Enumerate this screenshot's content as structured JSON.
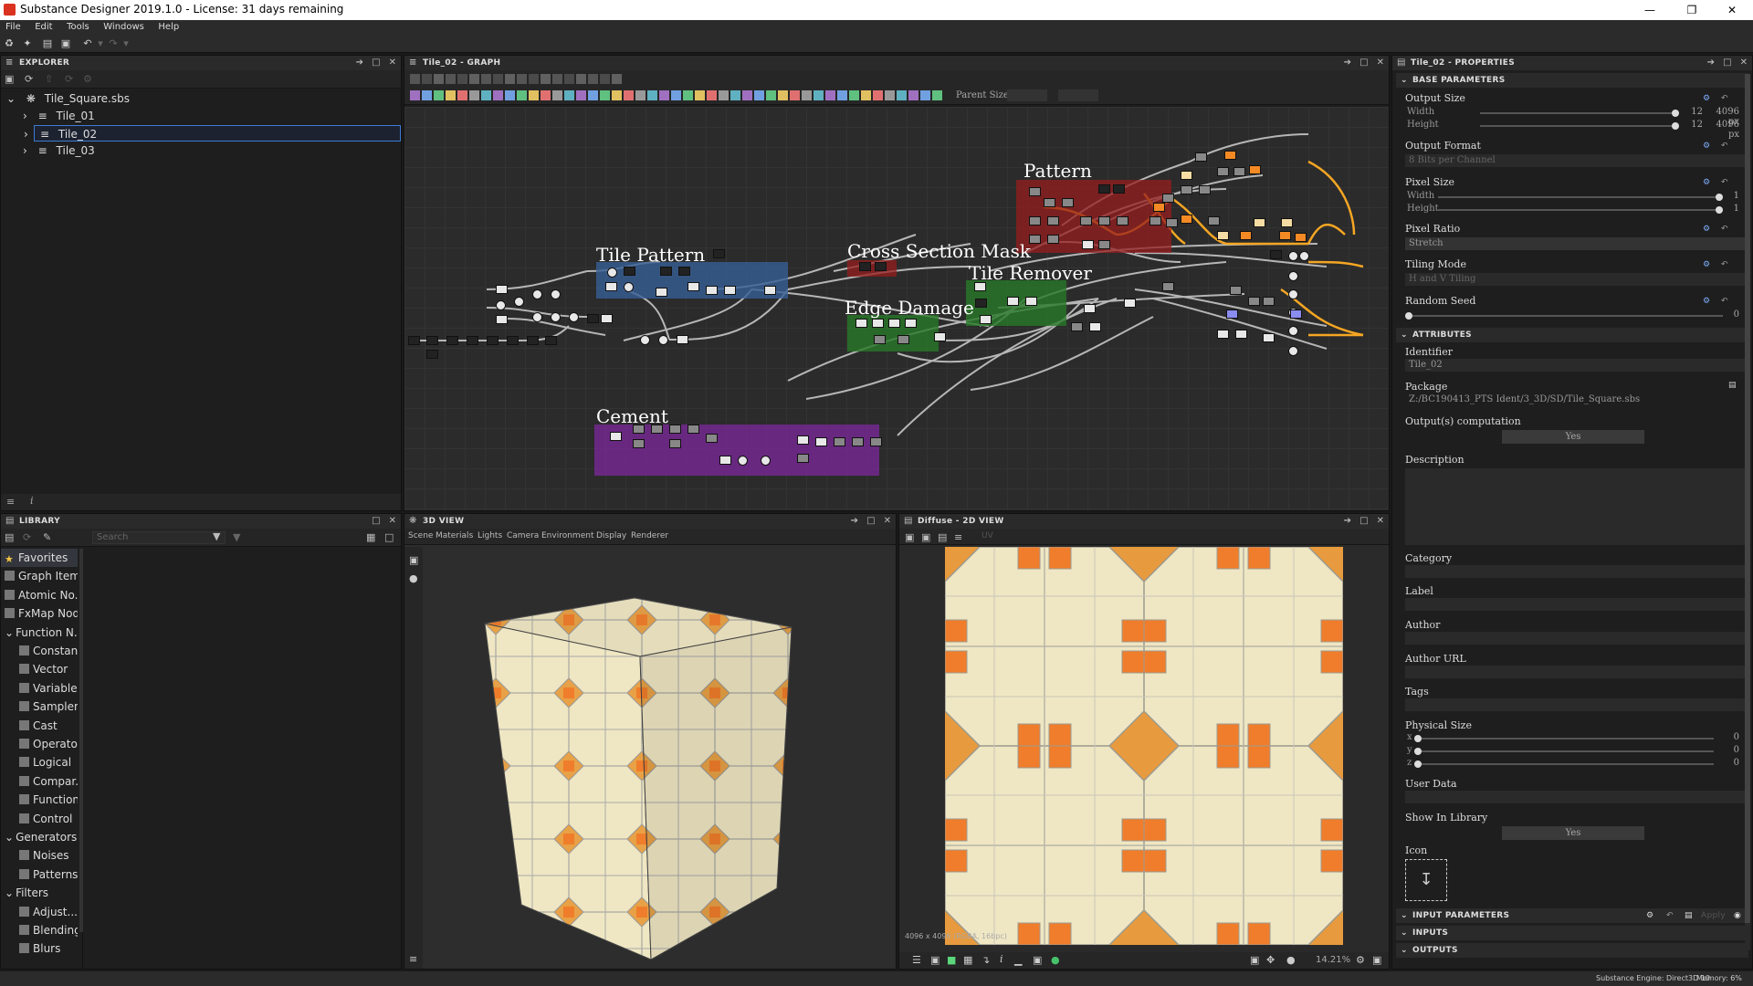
{
  "window": {
    "title": "Substance Designer 2019.1.0 - License: 31 days remaining"
  },
  "menu": [
    "File",
    "Edit",
    "Tools",
    "Windows",
    "Help"
  ],
  "explorer": {
    "title": "EXPLORER",
    "package": "Tile_Square.sbs",
    "graphs": [
      "Tile_01",
      "Tile_02",
      "Tile_03"
    ],
    "selected": "Tile_02"
  },
  "graph_view": {
    "title": "Tile_02 - GRAPH",
    "parent_size_label": "Parent Size:",
    "frames": [
      "Pattern",
      "Tile Pattern",
      "Cross Section Mask",
      "Tile Remover",
      "Edge Damage",
      "Cement"
    ]
  },
  "library": {
    "title": "LIBRARY",
    "search_placeholder": "Search",
    "items": [
      {
        "label": "Favorites",
        "level": 0,
        "selected": true
      },
      {
        "label": "Graph Items",
        "level": 0
      },
      {
        "label": "Atomic No...",
        "level": 0
      },
      {
        "label": "FxMap Nod...",
        "level": 0
      },
      {
        "label": "Function N...",
        "level": 0,
        "expanded": true
      },
      {
        "label": "Constant",
        "level": 1
      },
      {
        "label": "Vector",
        "level": 1
      },
      {
        "label": "Variable",
        "level": 1
      },
      {
        "label": "Sampler",
        "level": 1
      },
      {
        "label": "Cast",
        "level": 1
      },
      {
        "label": "Operator",
        "level": 1
      },
      {
        "label": "Logical",
        "level": 1
      },
      {
        "label": "Compar...",
        "level": 1
      },
      {
        "label": "Function",
        "level": 1
      },
      {
        "label": "Control",
        "level": 1
      },
      {
        "label": "Generators",
        "level": 0,
        "expanded": true
      },
      {
        "label": "Noises",
        "level": 1
      },
      {
        "label": "Patterns",
        "level": 1
      },
      {
        "label": "Filters",
        "level": 0,
        "expanded": true
      },
      {
        "label": "Adjust...",
        "level": 1
      },
      {
        "label": "Blending",
        "level": 1
      },
      {
        "label": "Blurs",
        "level": 1
      }
    ]
  },
  "view3d": {
    "title": "3D VIEW",
    "menus": [
      "Scene",
      "Materials",
      "Lights",
      "Camera",
      "Environment",
      "Display",
      "Renderer"
    ]
  },
  "view2d": {
    "title": "Diffuse - 2D VIEW",
    "uv_label": "UV",
    "resolution": "4096 x 4096 (RGBA, 16bpc)",
    "zoom": "14.21%"
  },
  "properties": {
    "title": "Tile_02 - PROPERTIES",
    "base_section": "BASE PARAMETERS",
    "output_size": {
      "label": "Output Size",
      "width_label": "Width",
      "height_label": "Height",
      "width_value": "12",
      "height_value": "12",
      "width_px": "4096 px",
      "height_px": "4096 px"
    },
    "output_format": {
      "label": "Output Format",
      "value": "8 Bits per Channel"
    },
    "pixel_size": {
      "label": "Pixel Size",
      "width_label": "Width",
      "height_label": "Height",
      "width_value": "1",
      "height_value": "1"
    },
    "pixel_ratio": {
      "label": "Pixel Ratio",
      "value": "Stretch"
    },
    "tiling_mode": {
      "label": "Tiling Mode",
      "value": "H and V Tiling"
    },
    "random_seed": {
      "label": "Random Seed",
      "value": "0"
    },
    "attributes_section": "ATTRIBUTES",
    "identifier": {
      "label": "Identifier",
      "value": "Tile_02"
    },
    "package": {
      "label": "Package",
      "value": "Z:/BC190413_PTS Ident/3_3D/SD/Tile_Square.sbs"
    },
    "outputs_computation": {
      "label": "Output(s) computation",
      "value": "Yes"
    },
    "description_label": "Description",
    "category_label": "Category",
    "label_label": "Label",
    "author_label": "Author",
    "author_url_label": "Author URL",
    "tags_label": "Tags",
    "physical_size": {
      "label": "Physical Size",
      "x_label": "x",
      "y_label": "y",
      "z_label": "z",
      "x": "0",
      "y": "0",
      "z": "0"
    },
    "user_data_label": "User Data",
    "show_in_library": {
      "label": "Show In Library",
      "value": "Yes"
    },
    "icon_label": "Icon",
    "input_params_section": "INPUT PARAMETERS",
    "apply_label": "Apply",
    "inputs_section": "INPUTS",
    "outputs_section": "OUTPUTS"
  },
  "status": {
    "engine": "Substance Engine: Direct3D 10",
    "memory": "Memory: 6%"
  },
  "colors": {
    "accent": "#3d7bd4",
    "tile_orange": "#f07d2b",
    "tile_cream": "#efe6c3",
    "wood": "#e8a146"
  }
}
